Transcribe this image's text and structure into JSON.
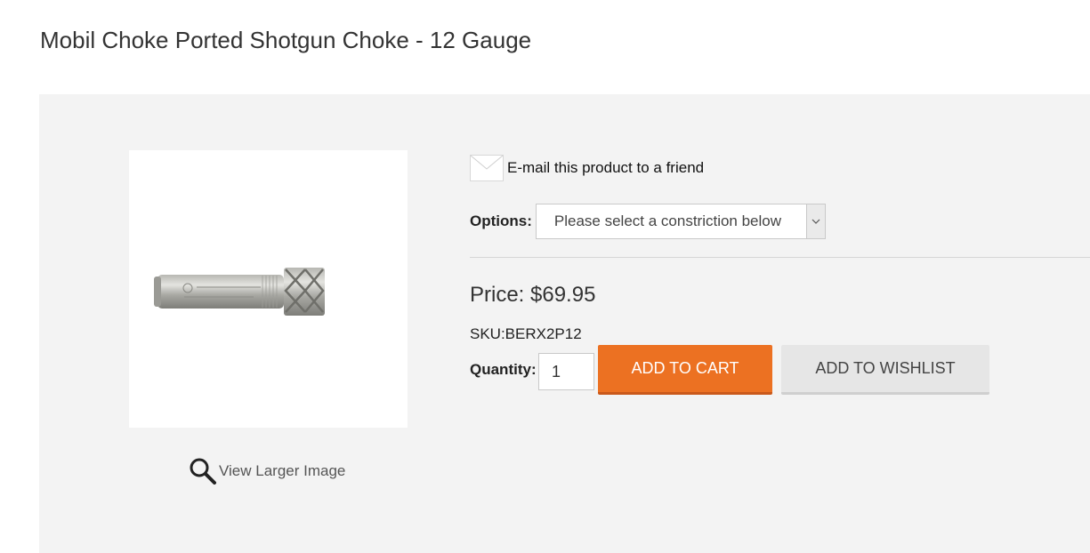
{
  "product": {
    "title": "Mobil Choke Ported Shotgun Choke - 12 Gauge",
    "image_alt": "BERETTA choke tube",
    "view_larger_label": "View Larger Image",
    "email_label": "E-mail this product to a friend",
    "options_label": "Options:",
    "options_selected": "Please select a constriction below",
    "price_text": "Price: $69.95",
    "sku_text": "SKU:BERX2P12",
    "quantity_label": "Quantity:",
    "quantity_value": "1",
    "add_to_cart_label": "ADD TO CART",
    "add_to_wishlist_label": "ADD TO WISHLIST"
  },
  "icons": {
    "search": "magnifier-icon",
    "email": "envelope-icon",
    "dropdown": "chevron-down-icon"
  },
  "colors": {
    "accent": "#ec7122",
    "panel_background": "#f3f3f3",
    "wishlist_button": "#e6e6e6"
  }
}
